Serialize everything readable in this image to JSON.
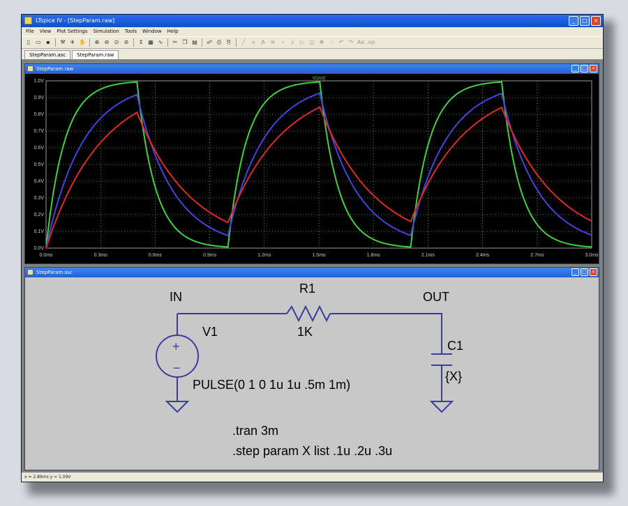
{
  "window": {
    "title": "LTspice IV - [StepParam.raw]"
  },
  "menu": [
    "File",
    "View",
    "Plot Settings",
    "Simulation",
    "Tools",
    "Window",
    "Help"
  ],
  "toolbar": {
    "icons": [
      "new-icon",
      "open-icon",
      "save-icon",
      "control-panel-icon",
      "run-icon",
      "halt-icon",
      "zoom-in-icon",
      "zoom-out-icon",
      "zoom-fit-icon",
      "zoom-cancel-icon",
      "autorange-icon",
      "grid-icon",
      "waveform-icon",
      "cut-icon",
      "copy-icon",
      "paste-icon",
      "find-icon",
      "print-setup-icon",
      "print-icon",
      "wire-icon",
      "ground-icon",
      "label-icon",
      "resistor-icon",
      "capacitor-icon",
      "inductor-icon",
      "diode-icon",
      "component-icon",
      "move-icon",
      "drag-icon",
      "undo-icon",
      "redo-icon",
      "text-icon",
      "spice-directive-icon"
    ]
  },
  "tabs": [
    "StepParam.asc",
    "StepParam.raw"
  ],
  "plot_window": {
    "title": "StepParam.raw",
    "trace_label": "V(out)"
  },
  "schematic_window": {
    "title": "StepParam.asc",
    "labels": {
      "in": "IN",
      "out": "OUT",
      "r1_name": "R1",
      "r1_value": "1K",
      "v1_name": "V1",
      "v1_value": "PULSE(0 1 0 1u 1u .5m 1m)",
      "c1_name": "C1",
      "c1_value": "{X}",
      "plus": "+",
      "minus": "−",
      "directive_tran": ".tran 3m",
      "directive_step": ".step param X list .1u .2u .3u"
    }
  },
  "status": {
    "text": "x = 2.89ms   y = 1.09V"
  },
  "colors": {
    "trace_green": "#3fd23f",
    "trace_blue": "#4444e0",
    "trace_red": "#e02828",
    "wire": "#3c3ca0",
    "grid": "#707070",
    "axis_text": "#c8c8c8"
  },
  "chart_data": {
    "type": "line",
    "xlabel": "",
    "ylabel": "",
    "xlim": [
      0,
      3.0
    ],
    "ylim": [
      0,
      1.0
    ],
    "x_ticks": [
      "0.0ms",
      "0.3ms",
      "0.6ms",
      "0.9ms",
      "1.2ms",
      "1.5ms",
      "1.8ms",
      "2.1ms",
      "2.4ms",
      "2.7ms",
      "3.0ms"
    ],
    "y_ticks": [
      "0.0V",
      "0.1V",
      "0.2V",
      "0.3V",
      "0.4V",
      "0.5V",
      "0.6V",
      "0.7V",
      "0.8V",
      "0.9V",
      "1.0V"
    ],
    "grid": true,
    "legend": "top-center",
    "series": [
      {
        "color": "#3fd23f",
        "tau_ms": 0.1
      },
      {
        "color": "#4444e0",
        "tau_ms": 0.2
      },
      {
        "color": "#e02828",
        "tau_ms": 0.3
      }
    ]
  }
}
